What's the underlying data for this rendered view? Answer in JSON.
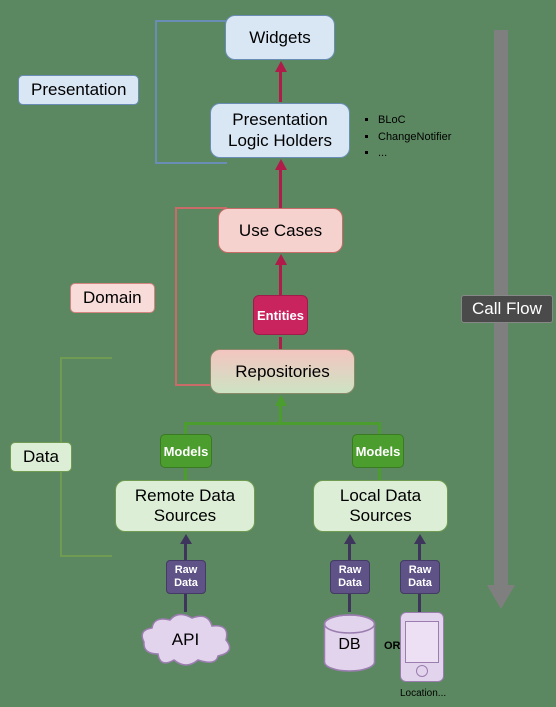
{
  "layers": {
    "presentation": {
      "label": "Presentation",
      "widgets": "Widgets",
      "plh": "Presentation\nLogic Holders",
      "bullets": [
        "BLoC",
        "ChangeNotifier",
        "..."
      ]
    },
    "domain": {
      "label": "Domain",
      "usecases": "Use Cases",
      "entities": "Entities"
    },
    "data": {
      "label": "Data",
      "repositories": "Repositories",
      "models": "Models",
      "remote": "Remote Data\nSources",
      "local": "Local Data\nSources",
      "raw": "Raw\nData",
      "api": "API",
      "db": "DB",
      "or": "OR",
      "location": "Location..."
    }
  },
  "callflow": "Call Flow"
}
